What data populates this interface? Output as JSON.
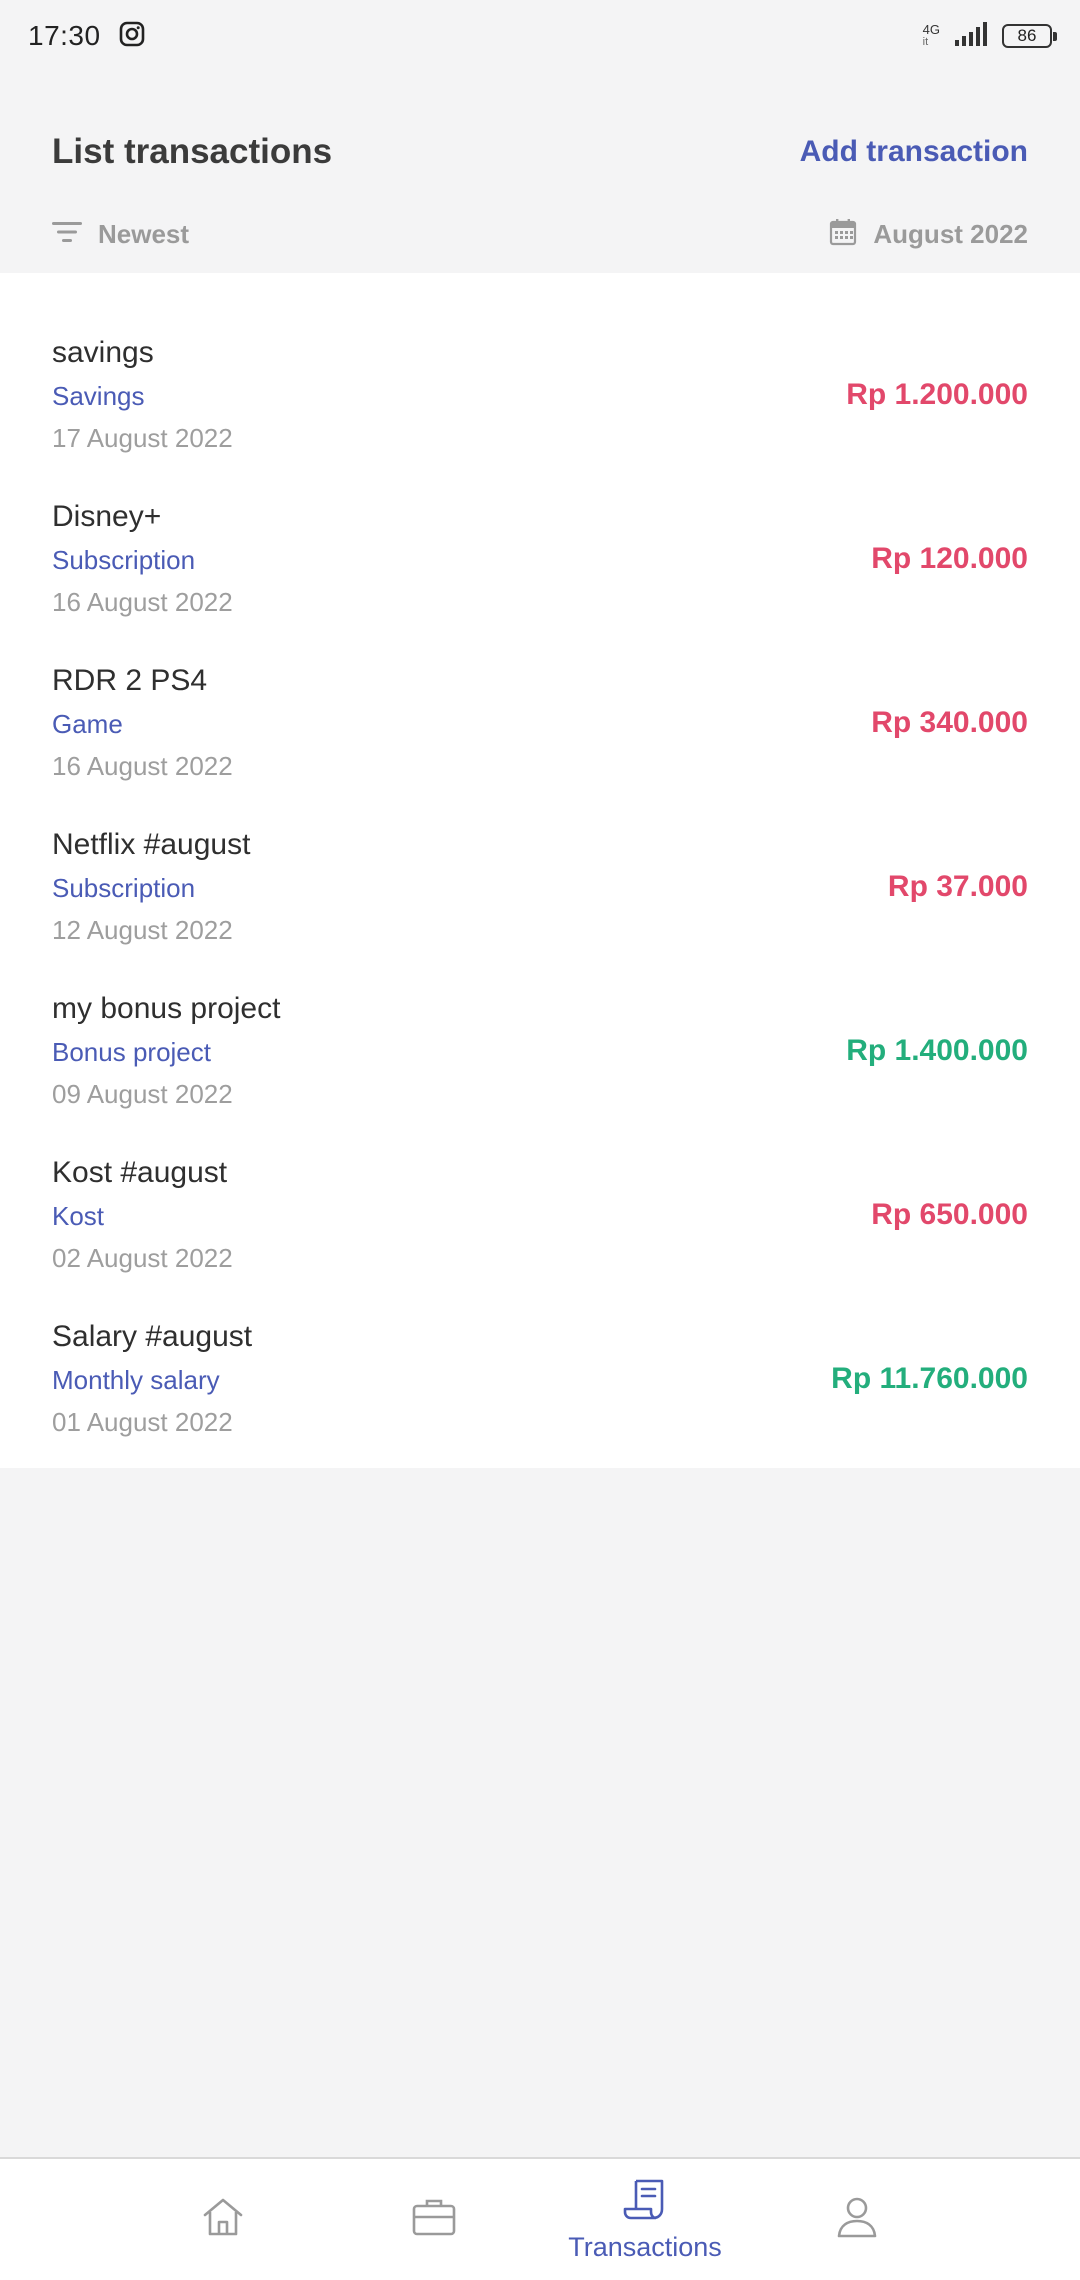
{
  "status_bar": {
    "time": "17:30",
    "network": "4G",
    "network_sub": "it",
    "battery": "86",
    "icons": [
      "instagram-icon",
      "signal-icon",
      "battery-icon"
    ]
  },
  "header": {
    "title": "List transactions",
    "add_label": "Add transaction"
  },
  "filters": {
    "sort_label": "Newest",
    "month_label": "August 2022",
    "icons": [
      "filter-icon",
      "calendar-icon"
    ]
  },
  "transactions": [
    {
      "name": "savings",
      "category": "Savings",
      "date": "17 August 2022",
      "amount": "Rp 1.200.000",
      "type": "expense"
    },
    {
      "name": "Disney+",
      "category": "Subscription",
      "date": "16 August 2022",
      "amount": "Rp 120.000",
      "type": "expense"
    },
    {
      "name": "RDR 2 PS4",
      "category": "Game",
      "date": "16 August 2022",
      "amount": "Rp 340.000",
      "type": "expense"
    },
    {
      "name": "Netflix #august",
      "category": "Subscription",
      "date": "12 August 2022",
      "amount": "Rp 37.000",
      "type": "expense"
    },
    {
      "name": "my bonus project",
      "category": "Bonus project",
      "date": "09 August 2022",
      "amount": "Rp 1.400.000",
      "type": "income"
    },
    {
      "name": "Kost #august",
      "category": "Kost",
      "date": "02 August 2022",
      "amount": "Rp 650.000",
      "type": "expense"
    },
    {
      "name": "Salary #august",
      "category": "Monthly salary",
      "date": "01 August 2022",
      "amount": "Rp 11.760.000",
      "type": "income"
    }
  ],
  "colors": {
    "accent": "#4a5bb5",
    "expense": "#e2486b",
    "income": "#23ae7c",
    "muted": "#9e9e9e"
  },
  "bottom_nav": {
    "items": [
      {
        "icon": "home-icon",
        "label": ""
      },
      {
        "icon": "briefcase-icon",
        "label": ""
      },
      {
        "icon": "receipt-icon",
        "label": "Transactions",
        "active": true
      },
      {
        "icon": "profile-icon",
        "label": ""
      }
    ]
  }
}
